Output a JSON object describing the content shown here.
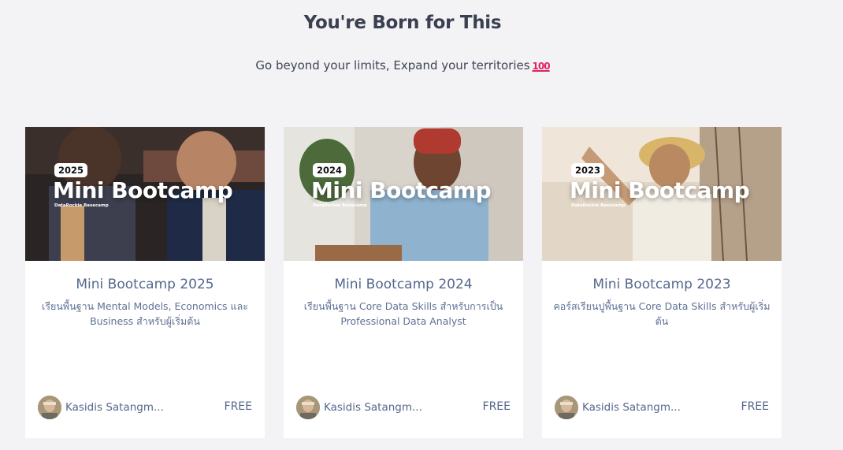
{
  "header": {
    "title": "You're Born for This",
    "subtitle": "Go beyond your limits, Expand your territories",
    "emoji": "100"
  },
  "cards": [
    {
      "year_badge": "2025",
      "thumb_title": "Mini Bootcamp",
      "thumb_brand": "DataRockie Basecamp",
      "title": "Mini Bootcamp 2025",
      "description": "เรียนพื้นฐาน Mental Models, Economics และ Business สำหรับผู้เริ่มต้น",
      "author": "Kasidis Satangm...",
      "price": "FREE"
    },
    {
      "year_badge": "2024",
      "thumb_title": "Mini Bootcamp",
      "thumb_brand": "DataRockie Basecamp",
      "title": "Mini Bootcamp 2024",
      "description": "เรียนพื้นฐาน Core Data Skills สำหรับการเป็น Professional Data Analyst",
      "author": "Kasidis Satangm...",
      "price": "FREE"
    },
    {
      "year_badge": "2023",
      "thumb_title": "Mini Bootcamp",
      "thumb_brand": "DataRockie Basecamp",
      "title": "Mini Bootcamp 2023",
      "description": "คอร์สเรียนปูพื้นฐาน Core Data Skills สำหรับผู้เริ่มต้น",
      "author": "Kasidis Satangm...",
      "price": "FREE"
    }
  ],
  "colors": {
    "page_bg": "#f3f3f6",
    "card_title": "#56688d",
    "heading": "#3b4050"
  }
}
